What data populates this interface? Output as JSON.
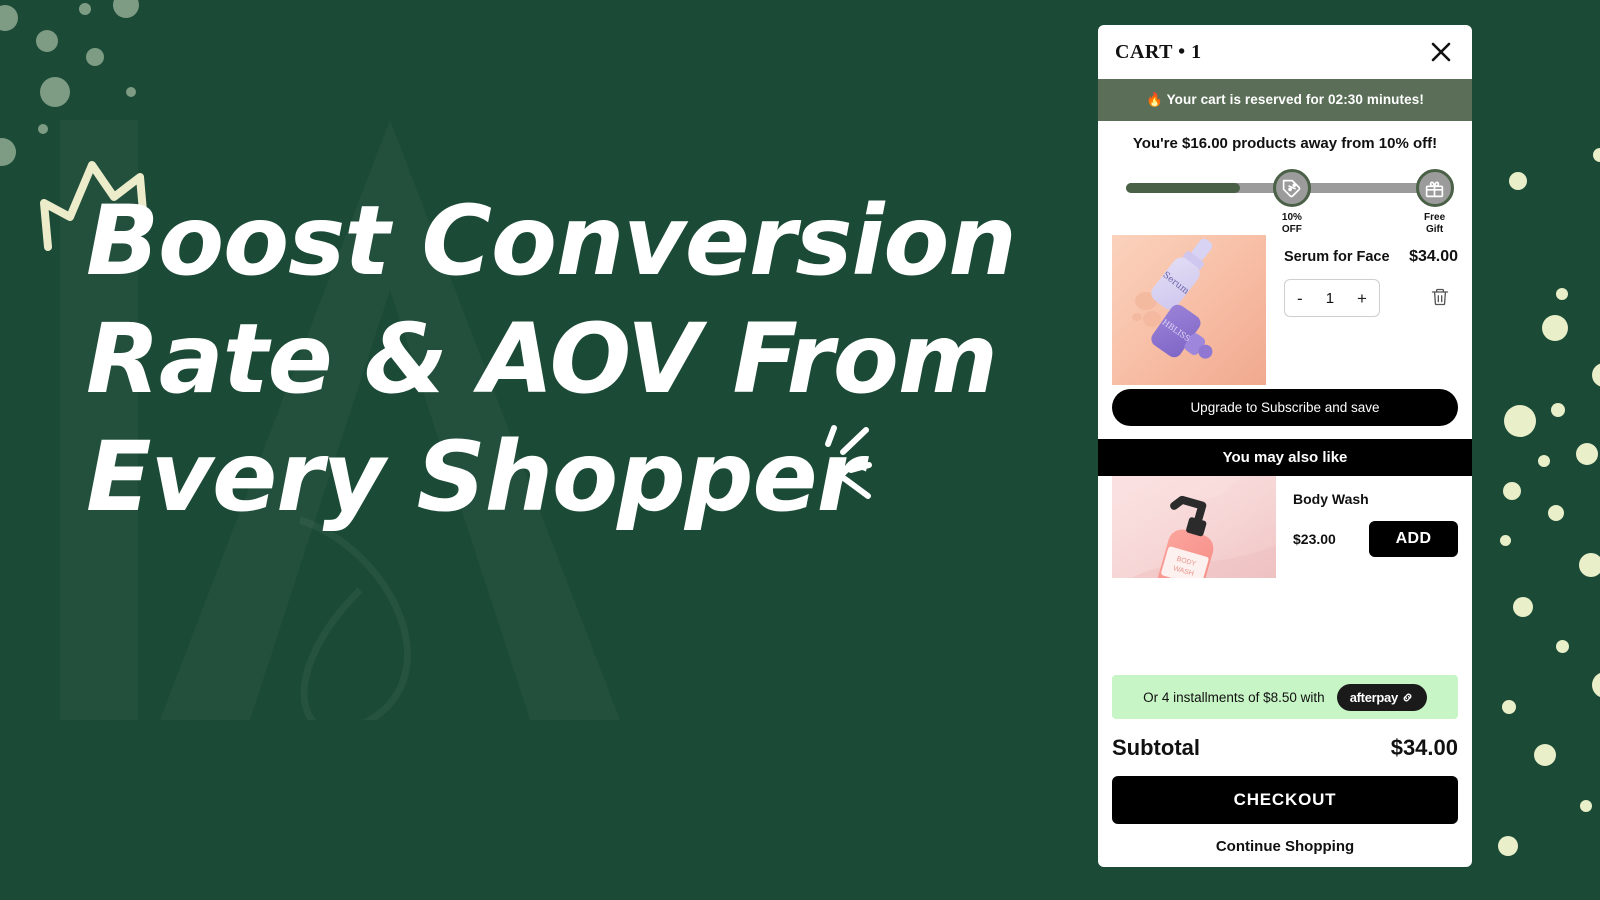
{
  "hero": {
    "headline_lines": [
      "Boost Conversion",
      "Rate & AOV From",
      "Every Shopper"
    ],
    "bg_color": "#1b4a36",
    "text_color": "#ffffff",
    "crown_color": "#ececcb",
    "dot_color_left": "#7e9b84",
    "dot_color_right": "#e8efc9"
  },
  "cart": {
    "title": "CART • 1",
    "close_icon": "close-icon",
    "reserve_notice": "🔥 Your cart is reserved for 02:30 minutes!",
    "reserve_bg": "#5b6f58",
    "progress": {
      "message": "You're $16.00 products away from 10% off!",
      "fill_percent": 36,
      "bar_color": "#4a6147",
      "track_color": "#9b9b9b",
      "milestones": [
        {
          "label": "10%\nOFF",
          "icon": "discount-tag-icon",
          "position_percent": 52
        },
        {
          "label": "Free\nGift",
          "icon": "gift-icon",
          "position_percent": 97
        }
      ]
    },
    "item": {
      "title": "Serum for Face",
      "price": "$34.00",
      "quantity": "1",
      "decrement_label": "-",
      "increment_label": "+",
      "remove_icon": "trash-icon",
      "image_alt": "serum-bottles-photo"
    },
    "subscribe_label": "Upgrade to Subscribe and save",
    "recommendations_heading": "You may also like",
    "recommendation": {
      "title": "Body Wash",
      "price": "$23.00",
      "add_label": "ADD",
      "image_alt": "body-wash-bottle-photo"
    },
    "afterpay": {
      "text": "Or 4 installments of $8.50 with",
      "brand": "afterpay",
      "bg": "#c8f5c6"
    },
    "subtotal_label": "Subtotal",
    "subtotal_value": "$34.00",
    "checkout_label": "CHECKOUT",
    "continue_label": "Continue Shopping"
  }
}
